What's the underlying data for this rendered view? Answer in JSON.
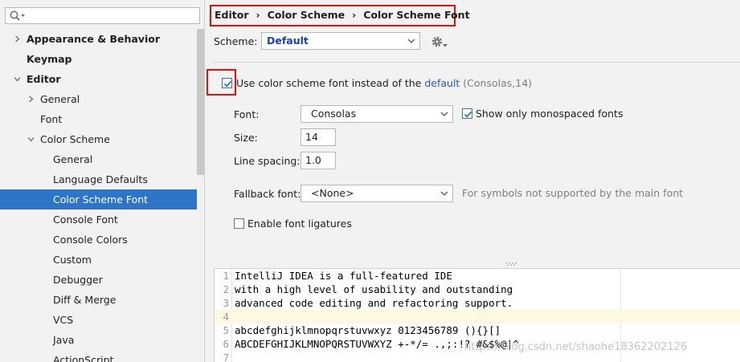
{
  "colors": {
    "accent": "#2f75c7",
    "highlight": "#e01010",
    "link": "#2d57b8",
    "scheme_text": "#1a3fb3"
  },
  "sidebar": {
    "search": {
      "placeholder": ""
    },
    "items": [
      {
        "label": "Appearance & Behavior",
        "level": 0,
        "expand": "collapsed",
        "bold": true
      },
      {
        "label": "Keymap",
        "level": 0,
        "expand": "none",
        "bold": true
      },
      {
        "label": "Editor",
        "level": 0,
        "expand": "expanded",
        "bold": true
      },
      {
        "label": "General",
        "level": 1,
        "expand": "collapsed",
        "bold": false
      },
      {
        "label": "Font",
        "level": 1,
        "expand": "none",
        "bold": false
      },
      {
        "label": "Color Scheme",
        "level": 1,
        "expand": "expanded",
        "bold": false
      },
      {
        "label": "General",
        "level": 2,
        "expand": "none",
        "bold": false
      },
      {
        "label": "Language Defaults",
        "level": 2,
        "expand": "none",
        "bold": false
      },
      {
        "label": "Color Scheme Font",
        "level": 2,
        "expand": "none",
        "bold": false,
        "selected": true
      },
      {
        "label": "Console Font",
        "level": 2,
        "expand": "none",
        "bold": false
      },
      {
        "label": "Console Colors",
        "level": 2,
        "expand": "none",
        "bold": false
      },
      {
        "label": "Custom",
        "level": 2,
        "expand": "none",
        "bold": false
      },
      {
        "label": "Debugger",
        "level": 2,
        "expand": "none",
        "bold": false
      },
      {
        "label": "Diff & Merge",
        "level": 2,
        "expand": "none",
        "bold": false
      },
      {
        "label": "VCS",
        "level": 2,
        "expand": "none",
        "bold": false
      },
      {
        "label": "Java",
        "level": 2,
        "expand": "none",
        "bold": false
      },
      {
        "label": "ActionScript",
        "level": 2,
        "expand": "none",
        "bold": false
      }
    ]
  },
  "breadcrumb": [
    "Editor",
    "Color Scheme",
    "Color Scheme Font"
  ],
  "scheme": {
    "label": "Scheme:",
    "value": "Default"
  },
  "use_scheme_font": {
    "checked": true,
    "text_before": "Use color scheme font instead of the ",
    "link": "default",
    "hint": " (Consolas,14)"
  },
  "font": {
    "label": "Font:",
    "value": "Consolas"
  },
  "monospaced": {
    "checked": true,
    "label": "Show only monospaced fonts"
  },
  "size": {
    "label": "Size:",
    "value": "14"
  },
  "line_spacing": {
    "label": "Line spacing:",
    "value": "1.0"
  },
  "fallback": {
    "label": "Fallback font:",
    "value": "<None>",
    "hint": "For symbols not supported by the main font"
  },
  "ligatures": {
    "checked": false,
    "label": "Enable font ligatures"
  },
  "preview": {
    "current_line": 4,
    "lines": [
      {
        "num": "1",
        "text": "IntelliJ IDEA is a full-featured IDE"
      },
      {
        "num": "2",
        "text": "with a high level of usability and outstanding"
      },
      {
        "num": "3",
        "text": "advanced code editing and refactoring support."
      },
      {
        "num": "4",
        "text": ""
      },
      {
        "num": "5",
        "text": "abcdefghijklmnopqrstuvwxyz 0123456789 (){}[]"
      },
      {
        "num": "6",
        "text": "ABCDEFGHIJKLMNOPQRSTUVWXYZ +-*/= .,;:!? #&$%@|^"
      },
      {
        "num": "7",
        "text": ""
      }
    ]
  },
  "watermark": "https://blog.csdn.net/shaohe18362202126"
}
